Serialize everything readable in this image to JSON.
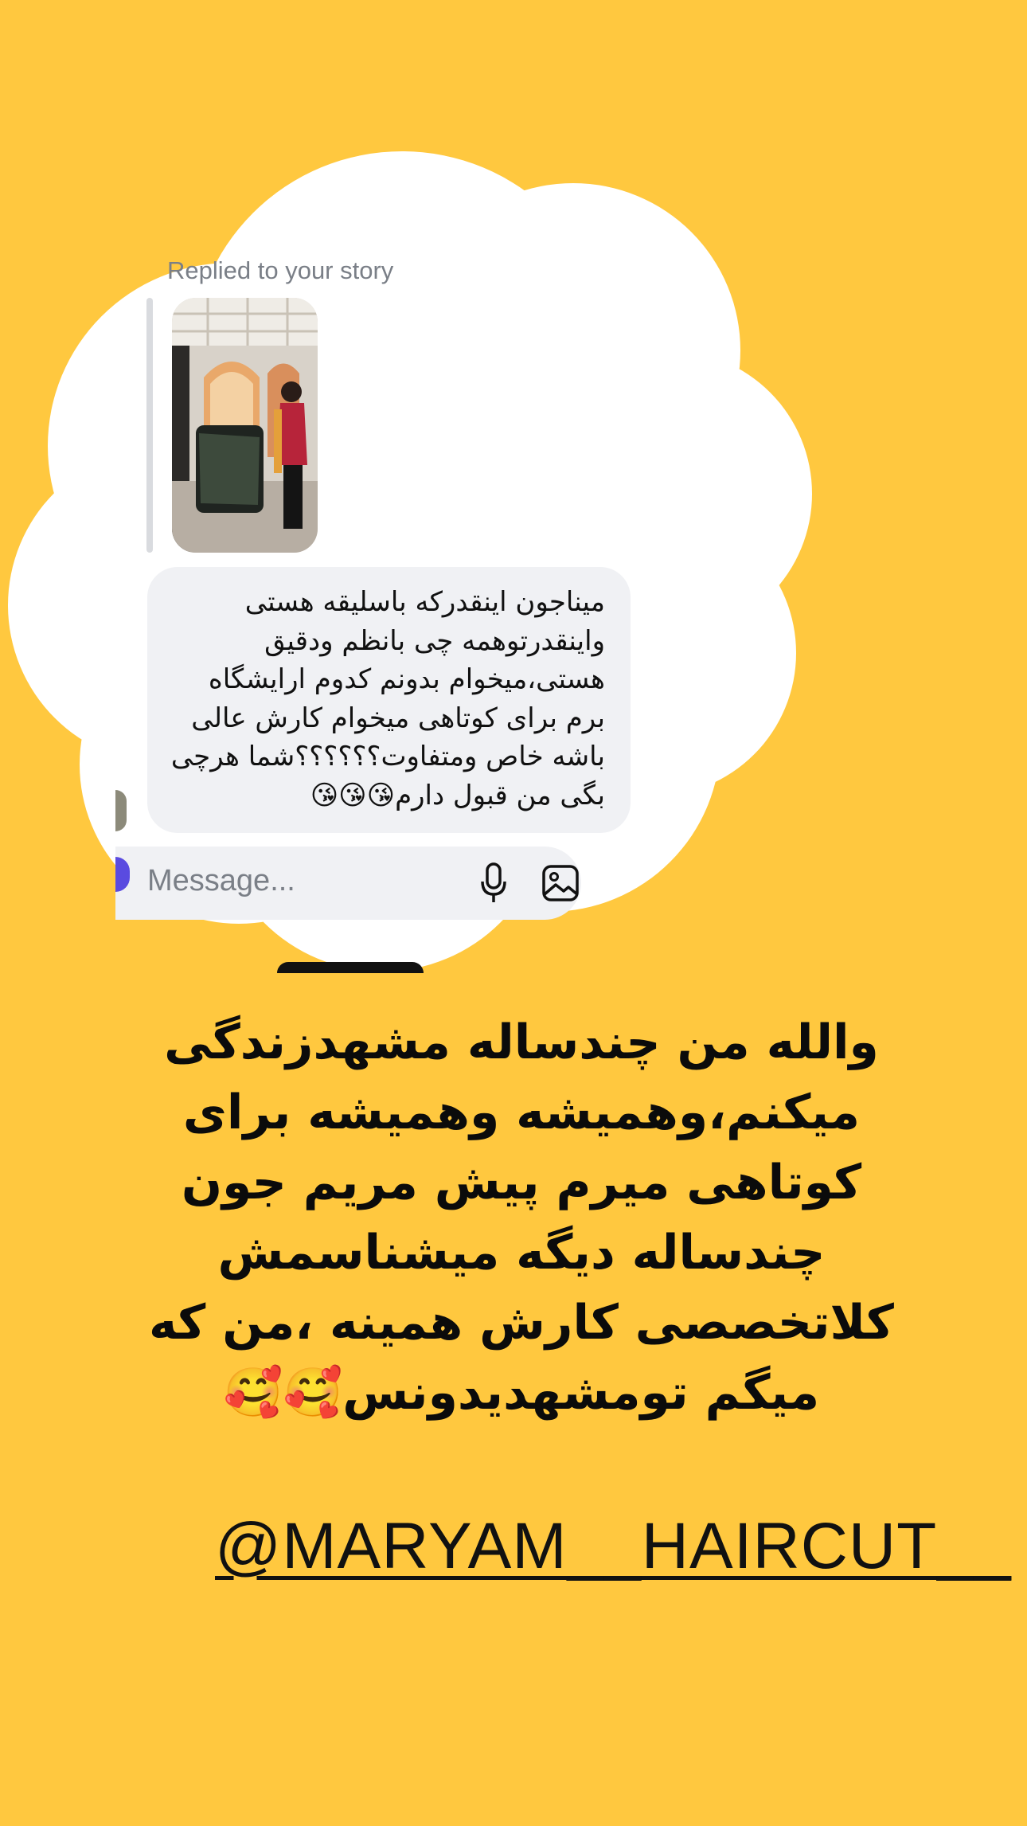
{
  "story_reply": {
    "label": "Replied to your story",
    "thumbnail_icon": "story-photo-thumbnail"
  },
  "message": {
    "text": "میناجون اینقدرکه باسلیقه هستی واینقدرتوهمه چی بانظم ودقیق هستی،میخوام بدونم کدوم ارایشگاه برم برای کوتاهی میخوام کارش عالی باشه خاص ومتفاوت؟؟؟؟؟؟شما هرچی بگی من قبول دارم😘😘😘"
  },
  "composer": {
    "placeholder": "Message...",
    "mic_icon": "microphone-icon",
    "gallery_icon": "image-gallery-icon"
  },
  "caption": {
    "text": "والله من چندساله مشهدزندگی میکنم،وهمیشه وهمیشه برای کوتاهی میرم پیش مریم جون چندساله دیگه میشناسمش کلاتخصصی کارش همینه ،من که میگم تومشهدیدونس🥰🥰"
  },
  "mention": {
    "text": "@MARYAM__HAIRCUT__"
  },
  "colors": {
    "background": "#FFC83F",
    "cloud": "#FFFFFF",
    "bubble": "#F0F1F4"
  }
}
